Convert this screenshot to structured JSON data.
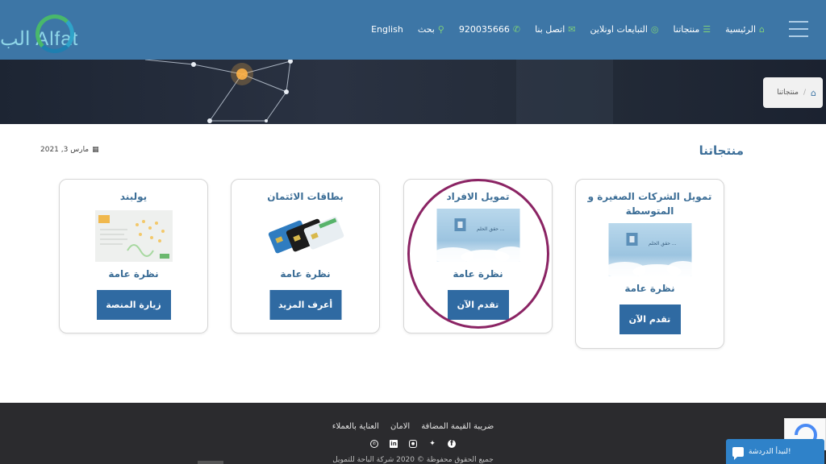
{
  "header": {
    "logo_text": "الب Alfat",
    "nav": [
      {
        "label": "الرئيسية",
        "icon": "⌂"
      },
      {
        "label": "منتجاتنا",
        "icon": "☰"
      },
      {
        "label": "التبايعات اونلاين",
        "icon": "◎"
      },
      {
        "label": "اتصل بنا",
        "icon": "✉"
      },
      {
        "label": "920035666",
        "icon": "✆"
      },
      {
        "label": "بحث",
        "icon": "⚲"
      },
      {
        "label": "English",
        "icon": ""
      }
    ]
  },
  "breadcrumb": {
    "home_icon": "home-icon",
    "separator": "/",
    "current": "منتجاتنا"
  },
  "page": {
    "title": "منتجاتنا",
    "date": "مارس 3, 2021",
    "date_icon": "calendar-icon"
  },
  "cards": [
    {
      "title": "تمويل الشركات الصغيرة و المتوسطة",
      "subtitle": "نظرة عامة",
      "button": "تقدم الآن",
      "image_text": "حقق الحلم ..."
    },
    {
      "title": "تمويل الافراد",
      "subtitle": "نظرة عامة",
      "button": "تقدم الآن",
      "image_text": "حقق الحلم ..."
    },
    {
      "title": "بطاقات الائتمان",
      "subtitle": "نظرة عامة",
      "button": "أعرف المزيد"
    },
    {
      "title": "يولبند",
      "subtitle": "نظرة عامة",
      "button": "زيارة المنصة"
    }
  ],
  "footer": {
    "links": [
      "ضريبة القيمة المضافة",
      "الامان",
      "العناية بالعملاء"
    ],
    "social": [
      "facebook-icon",
      "twitter-icon",
      "instagram-icon",
      "linkedin-icon",
      "whatsapp-icon"
    ],
    "copyright": "جميع الحقوق محفوظة © 2020 شركة الباحة للتمويل"
  },
  "chat": {
    "label": "لنبدأ الدردشة!"
  },
  "colors": {
    "header": "#3d76a6",
    "button": "#2f6aa2",
    "title": "#3b6d96",
    "footer": "#2b2b2e",
    "highlight_circle": "#8b2464"
  }
}
